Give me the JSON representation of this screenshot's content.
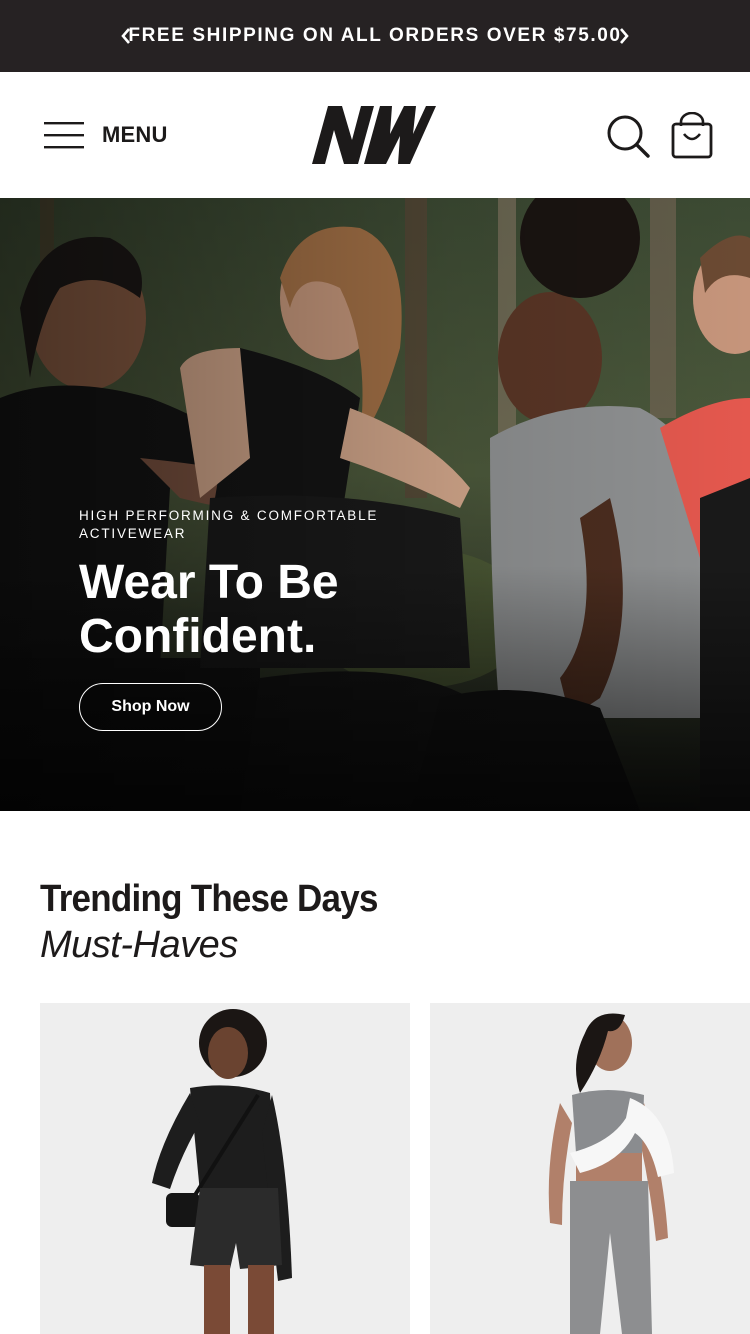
{
  "announcement": {
    "message": "FREE SHIPPING ON ALL ORDERS OVER $75.00",
    "prev_icon": "chevron-left-icon",
    "next_icon": "chevron-right-icon"
  },
  "header": {
    "menu_label": "MENU",
    "menu_icon": "hamburger-icon",
    "logo_text": "NW",
    "search_icon": "search-icon",
    "cart_icon": "shopping-bag-icon"
  },
  "hero": {
    "eyebrow": "HIGH PERFORMING & COMFORTABLE ACTIVEWEAR",
    "headline": "Wear To Be Confident.",
    "cta_label": "Shop Now"
  },
  "trending": {
    "title": "Trending These Days",
    "subtitle": "Must-Haves",
    "products": [
      {
        "image": "woman-black-long-sleeve-quilted-shorts"
      },
      {
        "image": "woman-grey-sports-bra-leggings"
      }
    ]
  },
  "colors": {
    "announcement_bg": "#262223",
    "text_dark": "#1d1a1a",
    "card_bg": "#eeeeee"
  }
}
